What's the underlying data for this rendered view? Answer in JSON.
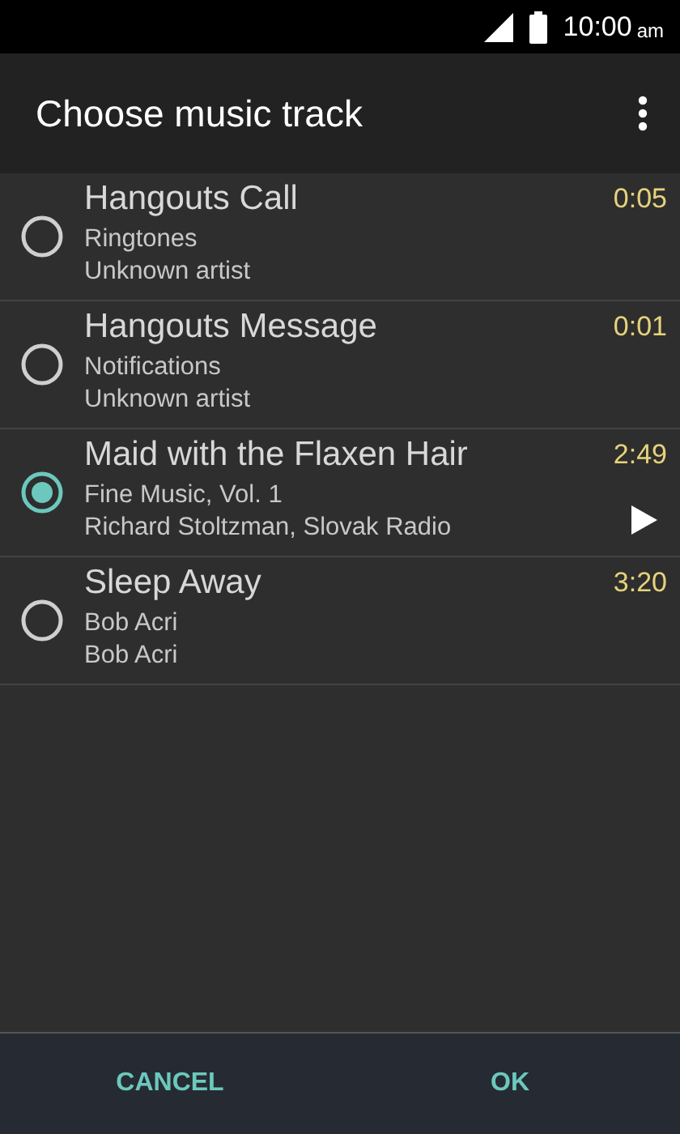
{
  "status_bar": {
    "time": "10:00",
    "meridiem": "am"
  },
  "app_bar": {
    "title": "Choose music track"
  },
  "tracks": [
    {
      "title": "Hangouts Call",
      "album": "Ringtones",
      "artist": "Unknown artist",
      "duration": "0:05",
      "selected": false
    },
    {
      "title": "Hangouts Message",
      "album": "Notifications",
      "artist": "Unknown artist",
      "duration": "0:01",
      "selected": false
    },
    {
      "title": "Maid with the Flaxen Hair",
      "album": "Fine Music, Vol. 1",
      "artist": "Richard Stoltzman, Slovak Radio",
      "duration": "2:49",
      "selected": true
    },
    {
      "title": "Sleep Away",
      "album": "Bob Acri",
      "artist": "Bob Acri",
      "duration": "3:20",
      "selected": false
    }
  ],
  "buttons": [
    "CANCEL",
    "OK"
  ]
}
